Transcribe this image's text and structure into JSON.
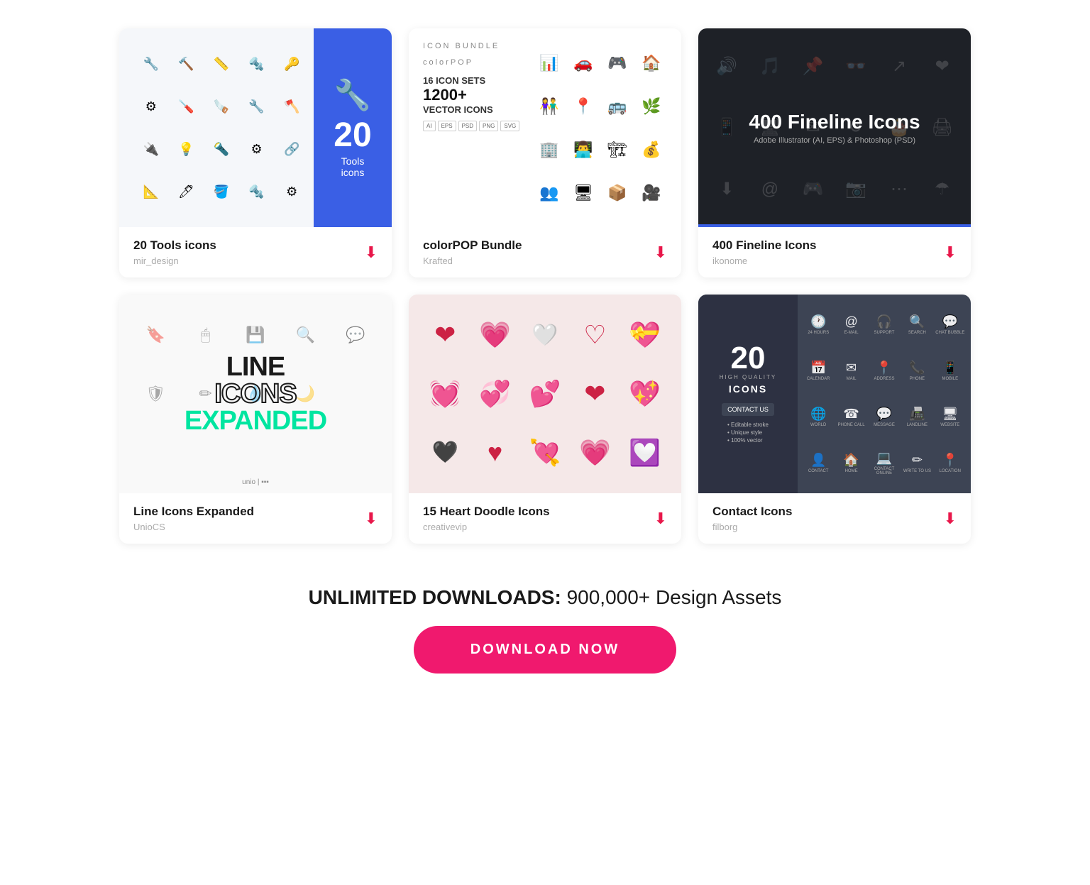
{
  "cards": [
    {
      "id": "tools",
      "title": "20 Tools icons",
      "author": "mir_design",
      "badge_number": "20",
      "badge_label": "Tools\nicons"
    },
    {
      "id": "colorpop",
      "title": "colorPOP Bundle",
      "author": "Krafted",
      "logo_main": "colorPOP",
      "logo_sub": "ICON BUNDLE",
      "sets_label": "ICON SETS",
      "sets_count": "16",
      "vector_big": "1200+",
      "vector_label": "VECTOR ICONS",
      "tags": [
        "AI",
        "EPS",
        "PSD",
        "PNG",
        "SVG"
      ]
    },
    {
      "id": "fineline",
      "title": "400 Fineline Icons",
      "author": "ikonome",
      "main_text": "400 Fineline Icons",
      "sub_text": "Adobe Illustrator (AI, EPS) & Photoshop (PSD)"
    },
    {
      "id": "lineicons",
      "title": "Line Icons Expanded",
      "author": "UnioCS"
    },
    {
      "id": "hearts",
      "title": "15 Heart Doodle Icons",
      "author": "creativevip"
    },
    {
      "id": "contact",
      "title": "Contact Icons",
      "author": "filborg",
      "number": "20",
      "quality": "HIGH QUALITY",
      "icons_label": "ICONS",
      "contact_us": "CONTACT US",
      "bullets": [
        "• Editable stroke",
        "• Unique style",
        "• 100% vector"
      ],
      "contact_items": [
        {
          "sym": "🕐",
          "label": "24 HOURS"
        },
        {
          "sym": "@",
          "label": "E-MAIL"
        },
        {
          "sym": "🎧",
          "label": "SUPPORT"
        },
        {
          "sym": "🔍",
          "label": "SEARCH"
        },
        {
          "sym": "💬",
          "label": "CHAT BUBBLE"
        },
        {
          "sym": "📅",
          "label": "CALENDAR"
        },
        {
          "sym": "✉",
          "label": "MAIL"
        },
        {
          "sym": "📍",
          "label": "ADDRESS"
        },
        {
          "sym": "📞",
          "label": "PHONE"
        },
        {
          "sym": "📱",
          "label": "MOBILE"
        },
        {
          "sym": "🌐",
          "label": "WORLD"
        },
        {
          "sym": "☎",
          "label": "PHONE CALL"
        },
        {
          "sym": "💬",
          "label": "MESSAGE"
        },
        {
          "sym": "📠",
          "label": "LANDLINE"
        },
        {
          "sym": "🖥",
          "label": "WEBSITE"
        },
        {
          "sym": "👤",
          "label": "CONTACT"
        },
        {
          "sym": "🏠",
          "label": "HOME"
        },
        {
          "sym": "💻",
          "label": "CONTACT ONLINE"
        },
        {
          "sym": "✏",
          "label": "WRITE TO US"
        },
        {
          "sym": "📍",
          "label": "LOCATION"
        }
      ]
    }
  ],
  "bottom": {
    "unlimited_label": "UNLIMITED DOWNLOADS:",
    "assets_label": "900,000+ Design Assets",
    "download_btn": "DOWNLOAD NOW"
  }
}
